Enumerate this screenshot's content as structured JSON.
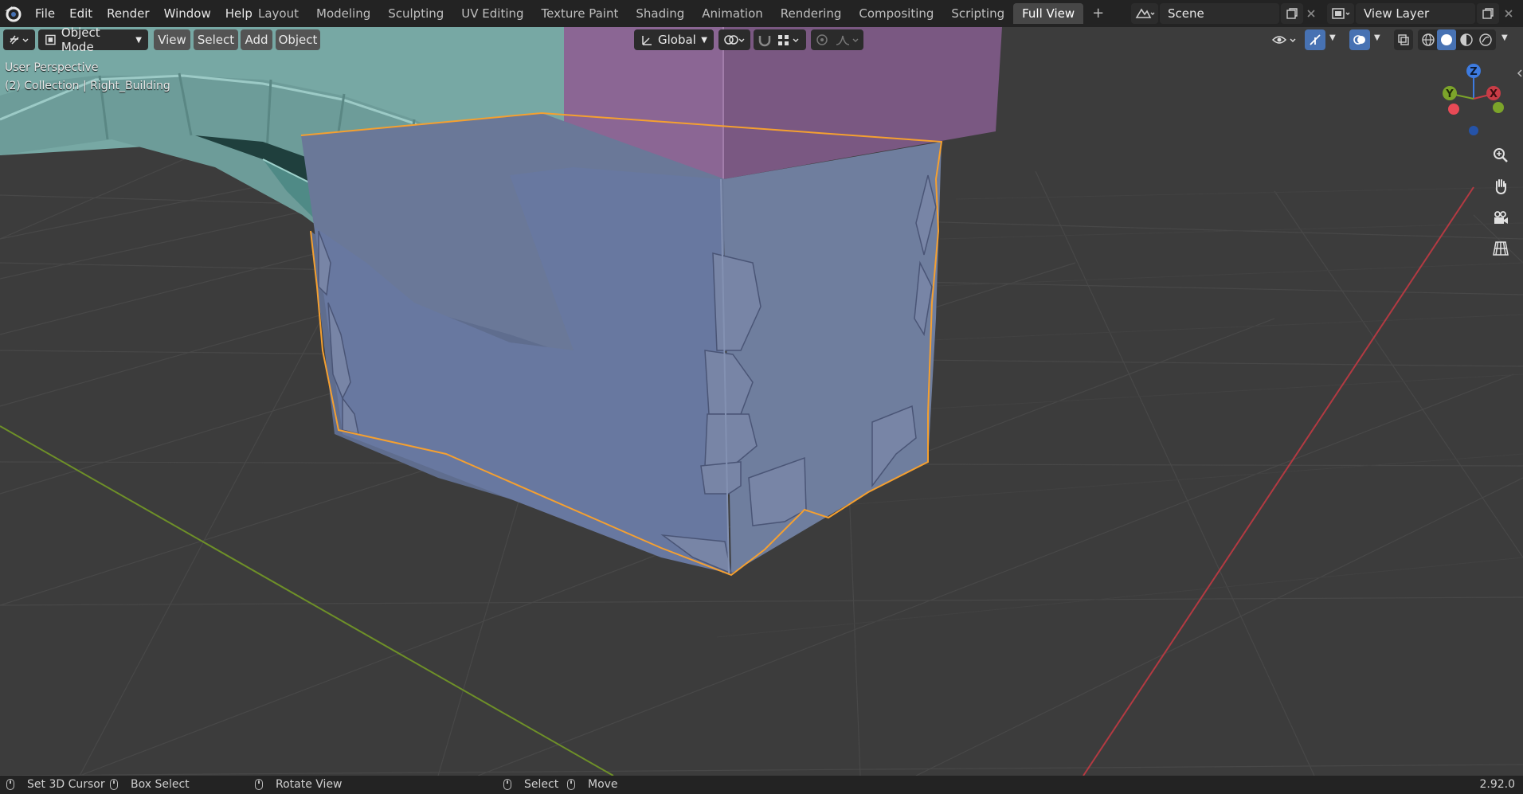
{
  "menu": {
    "items": [
      "File",
      "Edit",
      "Render",
      "Window",
      "Help"
    ]
  },
  "workspace_tabs": [
    "Layout",
    "Modeling",
    "Sculpting",
    "UV Editing",
    "Texture Paint",
    "Shading",
    "Animation",
    "Rendering",
    "Compositing",
    "Scripting",
    "Full View"
  ],
  "active_tab": "Full View",
  "scene": {
    "name": "Scene"
  },
  "view_layer": {
    "name": "View Layer"
  },
  "header": {
    "mode": "Object Mode",
    "view": "View",
    "select": "Select",
    "add": "Add",
    "object": "Object",
    "transform_orientation": "Global"
  },
  "overlay": {
    "perspective": "User Perspective",
    "collection": "(2) Collection | Right_Building"
  },
  "gizmo": {
    "z": "Z",
    "y": "Y",
    "x": "X"
  },
  "status": {
    "set_cursor": "Set 3D Cursor",
    "box_select": "Box Select",
    "rotate_view": "Rotate View",
    "select": "Select",
    "move": "Move",
    "version": "2.92.0"
  },
  "colors": {
    "accent": "#4772b3",
    "selection_outline": "#f5a030",
    "x_axis": "#c83c46",
    "y_axis": "#7ca42a",
    "z_axis": "#3d7be0"
  }
}
